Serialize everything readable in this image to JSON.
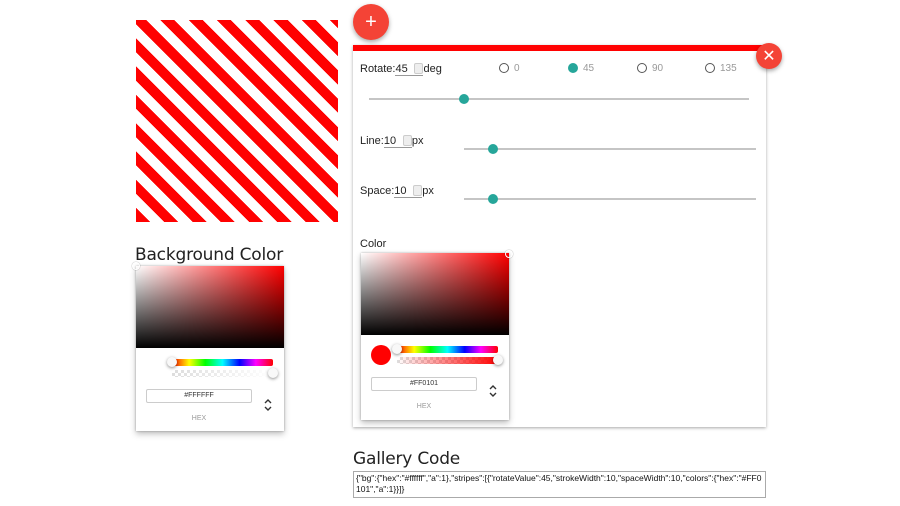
{
  "add_button": {
    "label": "+"
  },
  "close_button": {
    "label": "✕"
  },
  "background": {
    "title": "Background Color",
    "picker": {
      "hex": "#FFFFFF",
      "hex_label": "HEX",
      "hue_color": "#FF0000",
      "alpha": 1
    }
  },
  "stripes": {
    "accent": "#FF0101",
    "rotate": {
      "label": "Rotate:",
      "value": "45",
      "unit": "deg",
      "options": [
        {
          "label": "0",
          "checked": false
        },
        {
          "label": "45",
          "checked": true
        },
        {
          "label": "90",
          "checked": false
        },
        {
          "label": "135",
          "checked": false
        }
      ],
      "slider_fraction": 0.25
    },
    "line": {
      "label": "Line:",
      "value": "10",
      "unit": "px",
      "slider_fraction": 0.1
    },
    "space": {
      "label": "Space:",
      "value": "10",
      "unit": "px",
      "slider_fraction": 0.1
    },
    "color": {
      "label": "Color",
      "picker": {
        "hex": "#FF0101",
        "hex_label": "HEX",
        "hue_color": "#FF0000",
        "alpha": 1
      }
    }
  },
  "gallery": {
    "title": "Gallery Code",
    "code": "{\"bg\":{\"hex\":\"#ffffff\",\"a\":1},\"stripes\":[{\"rotateValue\":45,\"strokeWidth\":10,\"spaceWidth\":10,\"colors\":{\"hex\":\"#FF0101\",\"a\":1}}]}"
  },
  "theme": {
    "accent_teal": "#26a69a",
    "fab_red": "#f44336"
  }
}
